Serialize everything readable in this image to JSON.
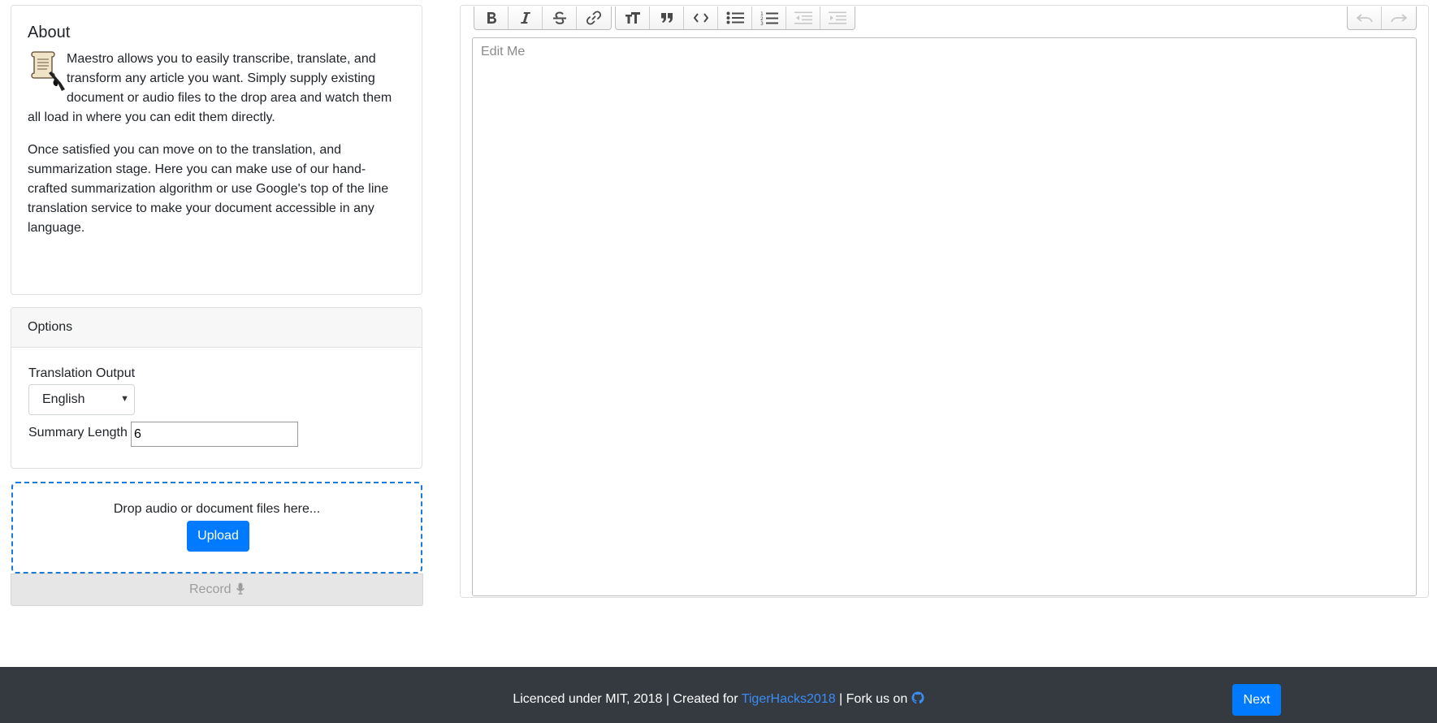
{
  "about": {
    "title": "About",
    "icon": "scroll-quill-icon",
    "paragraph1": "Maestro allows you to easily transcribe, translate, and transform any article you want. Simply supply existing document or audio files to the drop area and watch them all load in where you can edit them directly.",
    "paragraph2": "Once satisfied you can move on to the translation, and summarization stage. Here you can make use of our hand-crafted summarization algorithm or use Google's top of the line translation service to make your document accessible in any language."
  },
  "options": {
    "header": "Options",
    "translation_label": "Translation Output",
    "translation_value": "English",
    "summary_label": "Summary Length",
    "summary_value": "6"
  },
  "dropzone": {
    "text": "Drop audio or document files here...",
    "upload_label": "Upload",
    "record_label": "Record",
    "record_icon": "microphone-icon"
  },
  "editor": {
    "placeholder": "Edit Me",
    "toolbar": {
      "text_tools": [
        "bold-icon",
        "italic-icon",
        "strikethrough-icon",
        "link-icon"
      ],
      "block_tools": [
        "heading-icon",
        "quote-icon",
        "code-icon",
        "bullet-list-icon",
        "numbered-list-icon",
        "outdent-icon",
        "indent-icon"
      ],
      "history_tools": [
        "undo-icon",
        "redo-icon"
      ]
    }
  },
  "footer": {
    "text_before": "Licenced under MIT, 2018 | Created for ",
    "link_text": "TigerHacks2018",
    "text_after": " | Fork us on ",
    "github_icon": "github-icon",
    "next_label": "Next"
  },
  "colors": {
    "primary": "#007bff",
    "footer_bg": "#343a40",
    "link": "#3b8cf5",
    "dropzone_border": "#1b7ad6"
  }
}
